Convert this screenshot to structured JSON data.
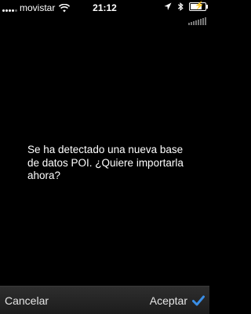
{
  "status_bar": {
    "carrier": "movistar",
    "time": "21:12",
    "signal_strength": 4,
    "signal_max": 5,
    "battery_level": 0.75,
    "icons": [
      "signal-dots-icon",
      "wifi-icon",
      "location-arrow-icon",
      "bluetooth-icon",
      "battery-icon",
      "signal-bars-icon"
    ]
  },
  "dialog": {
    "message": "Se ha detectado una nueva base\nde datos POI.  ¿Quiere importarla\nahora?"
  },
  "toolbar": {
    "cancel_label": "Cancelar",
    "accept_label": "Aceptar",
    "accent_color": "#3a8ee6"
  }
}
